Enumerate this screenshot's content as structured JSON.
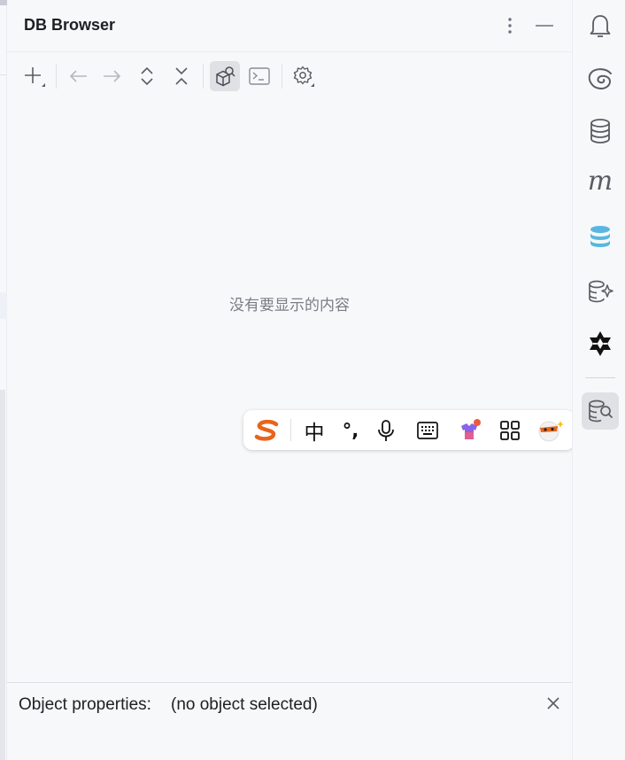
{
  "panel": {
    "title": "DB Browser",
    "header_actions": [
      "more-options",
      "minimize"
    ],
    "toolbar": [
      "add",
      "back",
      "forward",
      "expand-all",
      "collapse-all",
      "object-view",
      "console",
      "settings"
    ],
    "empty_message": "没有要显示的内容"
  },
  "properties": {
    "label": "Object properties:",
    "value": "(no object selected)"
  },
  "ime": {
    "logo": "sogou-s",
    "mode_label": "中",
    "punct_label": "°,",
    "icons": [
      "microphone",
      "keyboard",
      "skin",
      "apps-grid",
      "mascot"
    ]
  },
  "rightbar": {
    "icons": [
      "notifications",
      "ai-assistant",
      "database",
      "maven",
      "database-colored",
      "db-ai",
      "tongyi",
      "db-browser"
    ],
    "maven_label": "m",
    "active": "db-browser"
  },
  "colors": {
    "accent": "#e8641b",
    "db_blue": "#58b7e0",
    "active_bg": "#dfe1e5"
  }
}
